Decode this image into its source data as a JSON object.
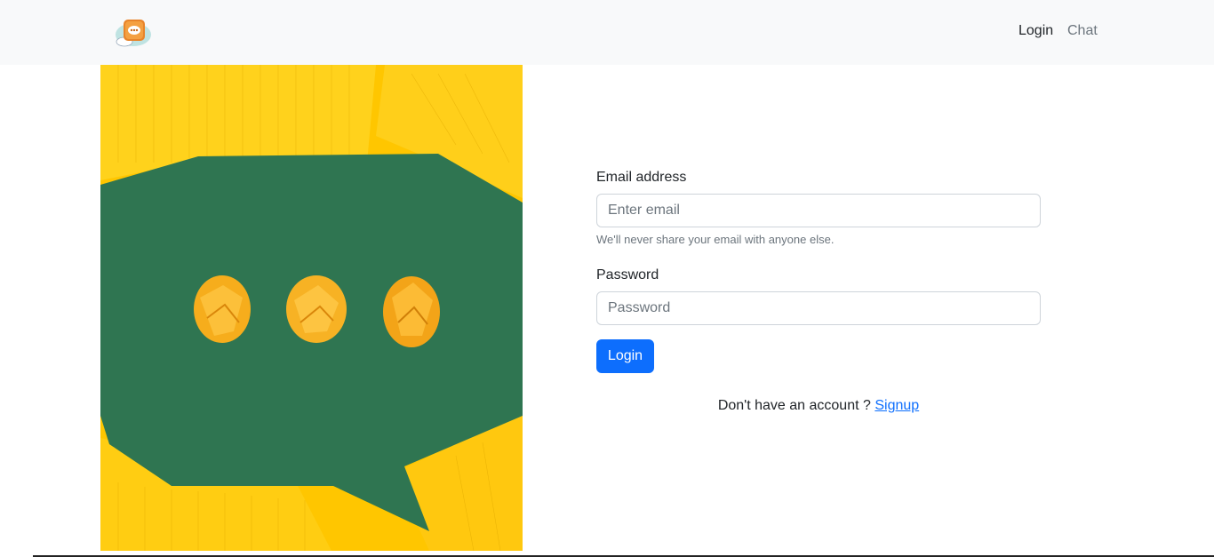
{
  "nav": {
    "brand_icon": "chat-bubble-logo-icon",
    "links": [
      {
        "label": "Login",
        "active": true
      },
      {
        "label": "Chat",
        "active": false
      }
    ]
  },
  "hero": {
    "image": "crumpled-paper-speech-bubble-image",
    "colors": {
      "background": "#ffc600",
      "bubble": "#2f7551",
      "paper_balls": "#f6ad1c"
    }
  },
  "form": {
    "email": {
      "label": "Email address",
      "placeholder": "Enter email",
      "help": "We'll never share your email with anyone else."
    },
    "password": {
      "label": "Password",
      "placeholder": "Password"
    },
    "submit_label": "Login",
    "signup_prompt": "Don't have an account ?",
    "signup_link": "Signup"
  },
  "colors": {
    "primary": "#0d6efd",
    "navbar_bg": "#f8f9fa",
    "muted": "#6c757d"
  }
}
